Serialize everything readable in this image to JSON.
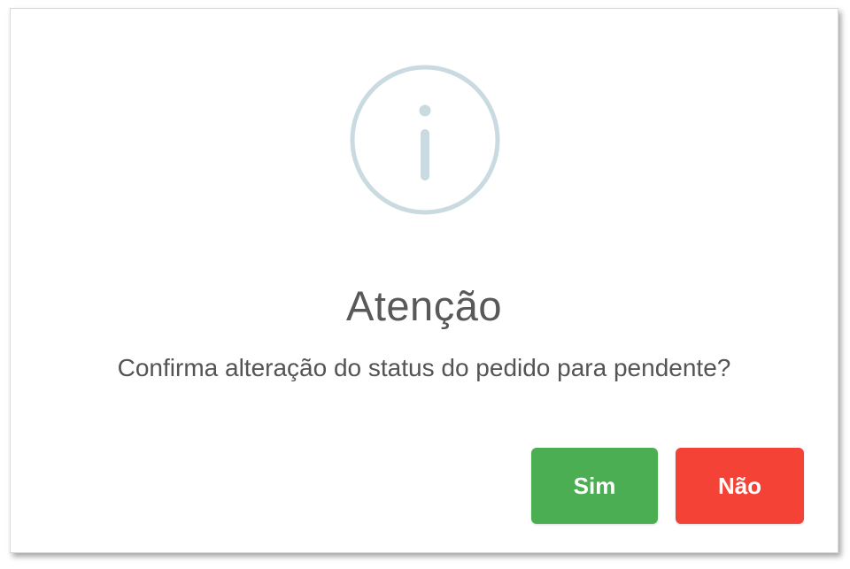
{
  "dialog": {
    "icon": "info-circle-icon",
    "title": "Atenção",
    "message": "Confirma alteração do status do pedido para pendente?",
    "confirm_label": "Sim",
    "cancel_label": "Não"
  },
  "colors": {
    "icon": "#c9dae1",
    "confirm": "#4cae52",
    "cancel": "#f44336",
    "title": "#595959",
    "message": "#545454"
  }
}
